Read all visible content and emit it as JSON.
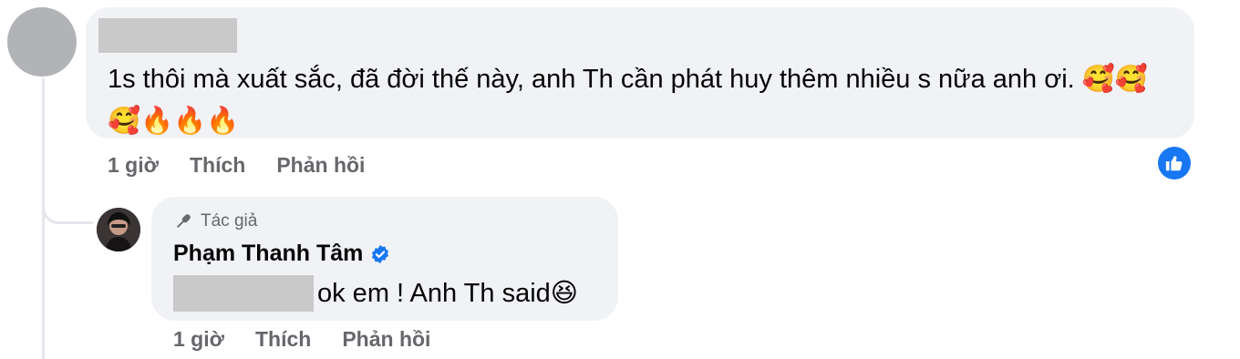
{
  "comment": {
    "text": "1s thôi mà xuất sắc, đã đời thế này, anh Th cần phát huy thêm nhiều s nữa anh ơi. 🥰🥰🥰🔥🔥🔥",
    "time": "1 giờ",
    "like_label": "Thích",
    "reply_label": "Phản hồi",
    "reaction_icon": "thumbs-up-icon",
    "reaction_color": "#1877f2"
  },
  "reply": {
    "author_badge": "Tác giả",
    "author_name": "Phạm Thanh Tâm",
    "text": "ok em ! Anh Th said😆",
    "time": "1 giờ",
    "like_label": "Thích",
    "reply_label": "Phản hồi",
    "verified_color": "#1877f2"
  }
}
